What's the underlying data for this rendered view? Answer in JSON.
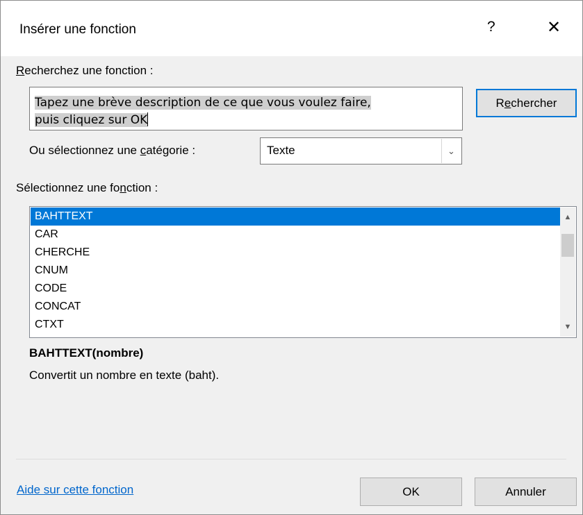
{
  "dialog": {
    "title": "Insérer une fonction",
    "help_glyph": "?",
    "close_glyph": "✕"
  },
  "search": {
    "label_first": "R",
    "label_rest": "echerchez une fonction :",
    "text_line1": "Tapez une brève description de ce que vous voulez faire,",
    "text_line2": "puis cliquez sur OK",
    "button_first": "Rechercher",
    "button_ul": "c",
    "button_rest": "hercher"
  },
  "category": {
    "label_pre": "Ou sélectionnez une ",
    "label_ul": "c",
    "label_post": "atégorie :",
    "selected": "Texte"
  },
  "functions": {
    "label_pre": "Sélectionnez une fo",
    "label_ul": "n",
    "label_post": "ction :",
    "items": [
      "BAHTTEXT",
      "CAR",
      "CHERCHE",
      "CNUM",
      "CODE",
      "CONCAT",
      "CTXT"
    ],
    "selected_index": 0
  },
  "details": {
    "syntax": "BAHTTEXT(nombre)",
    "description": "Convertit un nombre en texte (baht)."
  },
  "footer": {
    "help_link": "Aide sur cette fonction",
    "ok_label": "OK",
    "cancel_label": "Annuler"
  },
  "colors": {
    "accent": "#0078d7",
    "link": "#0066cc",
    "dialog_bg": "#f0f0f0"
  }
}
